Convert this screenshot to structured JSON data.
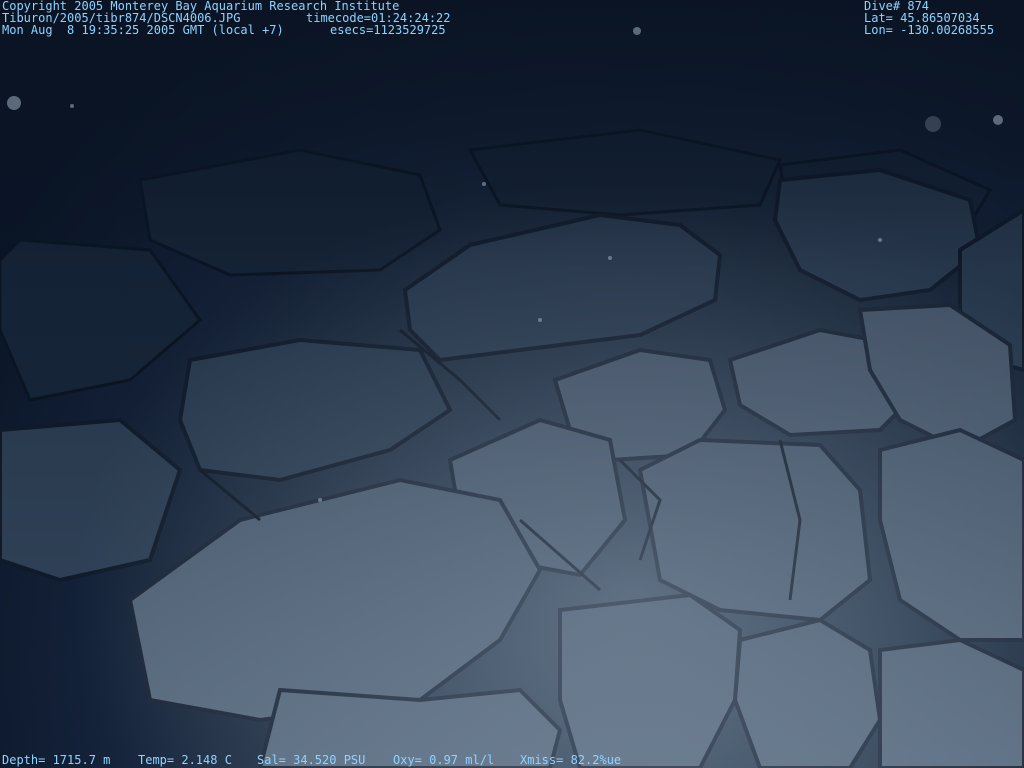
{
  "overlay": {
    "copyright": "Copyright 2005 Monterey Bay Aquarium Research Institute",
    "image_path": "Tiburon/2005/tibr874/DSCN4006.JPG",
    "timecode": "timecode=01:24:24:22",
    "datetime": "Mon Aug  8 19:35:25 2005 GMT (local +7)",
    "esecs": "esecs=1123529725",
    "dive": "Dive# 874",
    "lat": "Lat= 45.86507034",
    "lon": "Lon= -130.00268555",
    "depth": "Depth= 1715.7 m",
    "temp": "Temp= 2.148 C",
    "sal": "Sal= 34.520 PSU",
    "oxy": "Oxy= 0.97 ml/l",
    "xmiss": "Xmiss= 82.2%ue"
  },
  "colors": {
    "overlay_text": "#8fd3ff",
    "water": "#0b1628",
    "rock_light": "#6f8196",
    "rock_dark": "#1a2638"
  }
}
